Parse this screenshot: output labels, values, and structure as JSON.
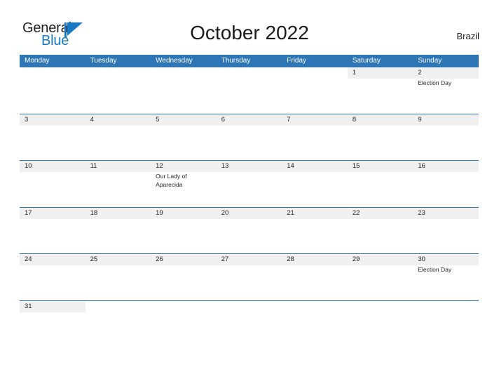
{
  "header": {
    "logo": {
      "word_one": "General",
      "word_two": "Blue",
      "mark_name": "general-blue-triangle-logo",
      "color_blue": "#1878c4",
      "color_dark": "#231f20"
    },
    "title": "October 2022",
    "country": "Brazil"
  },
  "theme": {
    "header_blue": "#2e75b6",
    "band_gray": "#f0f0f0",
    "text_dark": "#231f20",
    "page_bg": "#ffffff"
  },
  "calendar": {
    "weekdays": [
      "Monday",
      "Tuesday",
      "Wednesday",
      "Thursday",
      "Friday",
      "Saturday",
      "Sunday"
    ],
    "weeks": [
      [
        {
          "day": "",
          "events": []
        },
        {
          "day": "",
          "events": []
        },
        {
          "day": "",
          "events": []
        },
        {
          "day": "",
          "events": []
        },
        {
          "day": "",
          "events": []
        },
        {
          "day": "1",
          "events": []
        },
        {
          "day": "2",
          "events": [
            "Election Day"
          ]
        }
      ],
      [
        {
          "day": "3",
          "events": []
        },
        {
          "day": "4",
          "events": []
        },
        {
          "day": "5",
          "events": []
        },
        {
          "day": "6",
          "events": []
        },
        {
          "day": "7",
          "events": []
        },
        {
          "day": "8",
          "events": []
        },
        {
          "day": "9",
          "events": []
        }
      ],
      [
        {
          "day": "10",
          "events": []
        },
        {
          "day": "11",
          "events": []
        },
        {
          "day": "12",
          "events": [
            "Our Lady of Aparecida"
          ]
        },
        {
          "day": "13",
          "events": []
        },
        {
          "day": "14",
          "events": []
        },
        {
          "day": "15",
          "events": []
        },
        {
          "day": "16",
          "events": []
        }
      ],
      [
        {
          "day": "17",
          "events": []
        },
        {
          "day": "18",
          "events": []
        },
        {
          "day": "19",
          "events": []
        },
        {
          "day": "20",
          "events": []
        },
        {
          "day": "21",
          "events": []
        },
        {
          "day": "22",
          "events": []
        },
        {
          "day": "23",
          "events": []
        }
      ],
      [
        {
          "day": "24",
          "events": []
        },
        {
          "day": "25",
          "events": []
        },
        {
          "day": "26",
          "events": []
        },
        {
          "day": "27",
          "events": []
        },
        {
          "day": "28",
          "events": []
        },
        {
          "day": "29",
          "events": []
        },
        {
          "day": "30",
          "events": [
            "Election Day"
          ]
        }
      ],
      [
        {
          "day": "31",
          "events": []
        },
        {
          "day": "",
          "events": []
        },
        {
          "day": "",
          "events": []
        },
        {
          "day": "",
          "events": []
        },
        {
          "day": "",
          "events": []
        },
        {
          "day": "",
          "events": []
        },
        {
          "day": "",
          "events": []
        }
      ]
    ]
  }
}
